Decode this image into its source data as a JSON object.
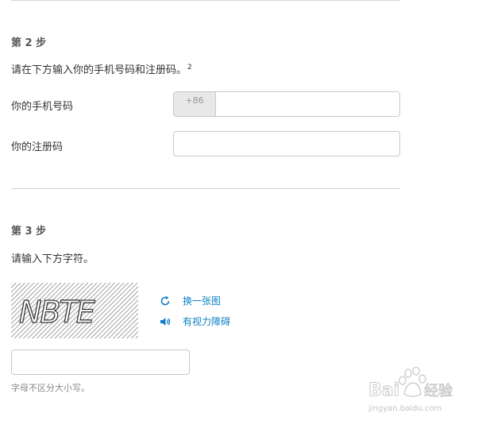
{
  "step2": {
    "title": "第 2 步",
    "instruction": "请在下方输入你的手机号码和注册码。",
    "footnote": "2",
    "phone_label": "你的手机号码",
    "phone_prefix": "+86",
    "phone_value": "",
    "code_label": "你的注册码",
    "code_value": ""
  },
  "step3": {
    "title": "第 3 步",
    "instruction": "请输入下方字符。",
    "captcha_text": "NBTE",
    "refresh_label": "换一张图",
    "audio_label": "有视力障碍",
    "captcha_value": "",
    "hint": "字母不区分大小写。"
  },
  "watermark": {
    "brand": "Bai",
    "brand_tail": "经验",
    "url": "jingyan.baidu.com"
  },
  "colors": {
    "link": "#0d7fc6",
    "divider": "#d6d6d6",
    "prefix_bg": "#e8e8e8"
  },
  "icons": {
    "refresh": "refresh-icon",
    "audio": "speaker-icon"
  }
}
